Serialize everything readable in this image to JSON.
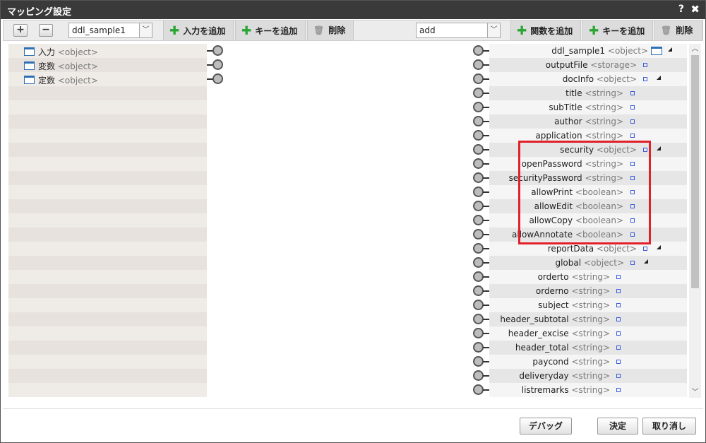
{
  "window": {
    "title": "マッピング設定",
    "help_label": "?",
    "close_label": "✖"
  },
  "toolbar": {
    "expand_label": "+",
    "collapse_label": "−",
    "left_select": "ddl_sample1",
    "left_add_input_label": "入力を追加",
    "left_add_key_label": "キーを追加",
    "left_delete_label": "削除",
    "right_select": "add",
    "right_add_function_label": "関数を追加",
    "right_add_key_label": "キーを追加",
    "right_delete_label": "削除"
  },
  "left_nodes": [
    {
      "name": "入力",
      "type": "<object>"
    },
    {
      "name": "変数",
      "type": "<object>"
    },
    {
      "name": "定数",
      "type": "<object>"
    }
  ],
  "right_nodes": [
    {
      "name": "ddl_sample1",
      "type": "<object>"
    },
    {
      "name": "outputFile",
      "type": "<storage>"
    },
    {
      "name": "docInfo",
      "type": "<object>"
    },
    {
      "name": "title",
      "type": "<string>"
    },
    {
      "name": "subTitle",
      "type": "<string>"
    },
    {
      "name": "author",
      "type": "<string>"
    },
    {
      "name": "application",
      "type": "<string>"
    },
    {
      "name": "security",
      "type": "<object>"
    },
    {
      "name": "openPassword",
      "type": "<string>"
    },
    {
      "name": "securityPassword",
      "type": "<string>"
    },
    {
      "name": "allowPrint",
      "type": "<boolean>"
    },
    {
      "name": "allowEdit",
      "type": "<boolean>"
    },
    {
      "name": "allowCopy",
      "type": "<boolean>"
    },
    {
      "name": "allowAnnotate",
      "type": "<boolean>"
    },
    {
      "name": "reportData",
      "type": "<object>"
    },
    {
      "name": "global",
      "type": "<object>"
    },
    {
      "name": "orderto",
      "type": "<string>"
    },
    {
      "name": "orderno",
      "type": "<string>"
    },
    {
      "name": "subject",
      "type": "<string>"
    },
    {
      "name": "header_subtotal",
      "type": "<string>"
    },
    {
      "name": "header_excise",
      "type": "<string>"
    },
    {
      "name": "header_total",
      "type": "<string>"
    },
    {
      "name": "paycond",
      "type": "<string>"
    },
    {
      "name": "deliveryday",
      "type": "<string>"
    },
    {
      "name": "listremarks",
      "type": "<string>"
    }
  ],
  "footer": {
    "debug_label": "デバッグ",
    "ok_label": "決定",
    "cancel_label": "取り消し"
  },
  "colors": {
    "highlight": "#e0202a",
    "add_icon": "#2aa534",
    "node_icon": "#2f6fb5"
  }
}
